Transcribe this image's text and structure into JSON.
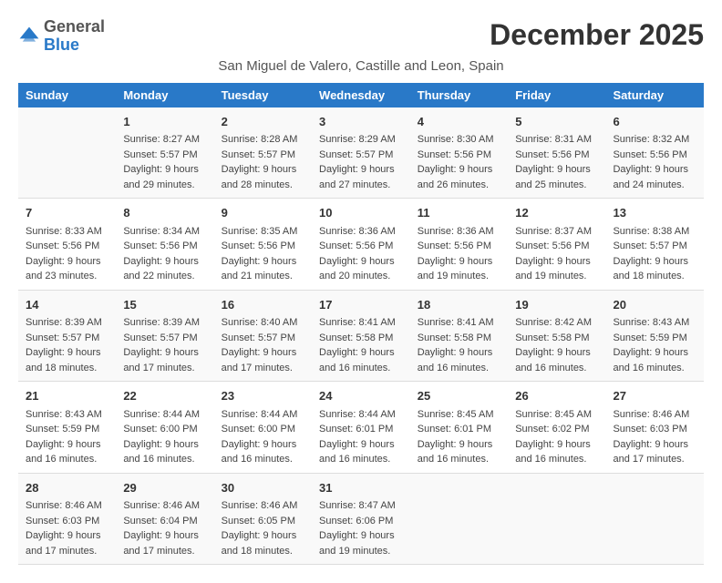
{
  "header": {
    "logo_line1": "General",
    "logo_line2": "Blue",
    "title": "December 2025",
    "subtitle": "San Miguel de Valero, Castille and Leon, Spain"
  },
  "columns": [
    "Sunday",
    "Monday",
    "Tuesday",
    "Wednesday",
    "Thursday",
    "Friday",
    "Saturday"
  ],
  "weeks": [
    [
      {
        "day": "",
        "sunrise": "",
        "sunset": "",
        "daylight": ""
      },
      {
        "day": "1",
        "sunrise": "Sunrise: 8:27 AM",
        "sunset": "Sunset: 5:57 PM",
        "daylight": "Daylight: 9 hours and 29 minutes."
      },
      {
        "day": "2",
        "sunrise": "Sunrise: 8:28 AM",
        "sunset": "Sunset: 5:57 PM",
        "daylight": "Daylight: 9 hours and 28 minutes."
      },
      {
        "day": "3",
        "sunrise": "Sunrise: 8:29 AM",
        "sunset": "Sunset: 5:57 PM",
        "daylight": "Daylight: 9 hours and 27 minutes."
      },
      {
        "day": "4",
        "sunrise": "Sunrise: 8:30 AM",
        "sunset": "Sunset: 5:56 PM",
        "daylight": "Daylight: 9 hours and 26 minutes."
      },
      {
        "day": "5",
        "sunrise": "Sunrise: 8:31 AM",
        "sunset": "Sunset: 5:56 PM",
        "daylight": "Daylight: 9 hours and 25 minutes."
      },
      {
        "day": "6",
        "sunrise": "Sunrise: 8:32 AM",
        "sunset": "Sunset: 5:56 PM",
        "daylight": "Daylight: 9 hours and 24 minutes."
      }
    ],
    [
      {
        "day": "7",
        "sunrise": "Sunrise: 8:33 AM",
        "sunset": "Sunset: 5:56 PM",
        "daylight": "Daylight: 9 hours and 23 minutes."
      },
      {
        "day": "8",
        "sunrise": "Sunrise: 8:34 AM",
        "sunset": "Sunset: 5:56 PM",
        "daylight": "Daylight: 9 hours and 22 minutes."
      },
      {
        "day": "9",
        "sunrise": "Sunrise: 8:35 AM",
        "sunset": "Sunset: 5:56 PM",
        "daylight": "Daylight: 9 hours and 21 minutes."
      },
      {
        "day": "10",
        "sunrise": "Sunrise: 8:36 AM",
        "sunset": "Sunset: 5:56 PM",
        "daylight": "Daylight: 9 hours and 20 minutes."
      },
      {
        "day": "11",
        "sunrise": "Sunrise: 8:36 AM",
        "sunset": "Sunset: 5:56 PM",
        "daylight": "Daylight: 9 hours and 19 minutes."
      },
      {
        "day": "12",
        "sunrise": "Sunrise: 8:37 AM",
        "sunset": "Sunset: 5:56 PM",
        "daylight": "Daylight: 9 hours and 19 minutes."
      },
      {
        "day": "13",
        "sunrise": "Sunrise: 8:38 AM",
        "sunset": "Sunset: 5:57 PM",
        "daylight": "Daylight: 9 hours and 18 minutes."
      }
    ],
    [
      {
        "day": "14",
        "sunrise": "Sunrise: 8:39 AM",
        "sunset": "Sunset: 5:57 PM",
        "daylight": "Daylight: 9 hours and 18 minutes."
      },
      {
        "day": "15",
        "sunrise": "Sunrise: 8:39 AM",
        "sunset": "Sunset: 5:57 PM",
        "daylight": "Daylight: 9 hours and 17 minutes."
      },
      {
        "day": "16",
        "sunrise": "Sunrise: 8:40 AM",
        "sunset": "Sunset: 5:57 PM",
        "daylight": "Daylight: 9 hours and 17 minutes."
      },
      {
        "day": "17",
        "sunrise": "Sunrise: 8:41 AM",
        "sunset": "Sunset: 5:58 PM",
        "daylight": "Daylight: 9 hours and 16 minutes."
      },
      {
        "day": "18",
        "sunrise": "Sunrise: 8:41 AM",
        "sunset": "Sunset: 5:58 PM",
        "daylight": "Daylight: 9 hours and 16 minutes."
      },
      {
        "day": "19",
        "sunrise": "Sunrise: 8:42 AM",
        "sunset": "Sunset: 5:58 PM",
        "daylight": "Daylight: 9 hours and 16 minutes."
      },
      {
        "day": "20",
        "sunrise": "Sunrise: 8:43 AM",
        "sunset": "Sunset: 5:59 PM",
        "daylight": "Daylight: 9 hours and 16 minutes."
      }
    ],
    [
      {
        "day": "21",
        "sunrise": "Sunrise: 8:43 AM",
        "sunset": "Sunset: 5:59 PM",
        "daylight": "Daylight: 9 hours and 16 minutes."
      },
      {
        "day": "22",
        "sunrise": "Sunrise: 8:44 AM",
        "sunset": "Sunset: 6:00 PM",
        "daylight": "Daylight: 9 hours and 16 minutes."
      },
      {
        "day": "23",
        "sunrise": "Sunrise: 8:44 AM",
        "sunset": "Sunset: 6:00 PM",
        "daylight": "Daylight: 9 hours and 16 minutes."
      },
      {
        "day": "24",
        "sunrise": "Sunrise: 8:44 AM",
        "sunset": "Sunset: 6:01 PM",
        "daylight": "Daylight: 9 hours and 16 minutes."
      },
      {
        "day": "25",
        "sunrise": "Sunrise: 8:45 AM",
        "sunset": "Sunset: 6:01 PM",
        "daylight": "Daylight: 9 hours and 16 minutes."
      },
      {
        "day": "26",
        "sunrise": "Sunrise: 8:45 AM",
        "sunset": "Sunset: 6:02 PM",
        "daylight": "Daylight: 9 hours and 16 minutes."
      },
      {
        "day": "27",
        "sunrise": "Sunrise: 8:46 AM",
        "sunset": "Sunset: 6:03 PM",
        "daylight": "Daylight: 9 hours and 17 minutes."
      }
    ],
    [
      {
        "day": "28",
        "sunrise": "Sunrise: 8:46 AM",
        "sunset": "Sunset: 6:03 PM",
        "daylight": "Daylight: 9 hours and 17 minutes."
      },
      {
        "day": "29",
        "sunrise": "Sunrise: 8:46 AM",
        "sunset": "Sunset: 6:04 PM",
        "daylight": "Daylight: 9 hours and 17 minutes."
      },
      {
        "day": "30",
        "sunrise": "Sunrise: 8:46 AM",
        "sunset": "Sunset: 6:05 PM",
        "daylight": "Daylight: 9 hours and 18 minutes."
      },
      {
        "day": "31",
        "sunrise": "Sunrise: 8:47 AM",
        "sunset": "Sunset: 6:06 PM",
        "daylight": "Daylight: 9 hours and 19 minutes."
      },
      {
        "day": "",
        "sunrise": "",
        "sunset": "",
        "daylight": ""
      },
      {
        "day": "",
        "sunrise": "",
        "sunset": "",
        "daylight": ""
      },
      {
        "day": "",
        "sunrise": "",
        "sunset": "",
        "daylight": ""
      }
    ]
  ]
}
